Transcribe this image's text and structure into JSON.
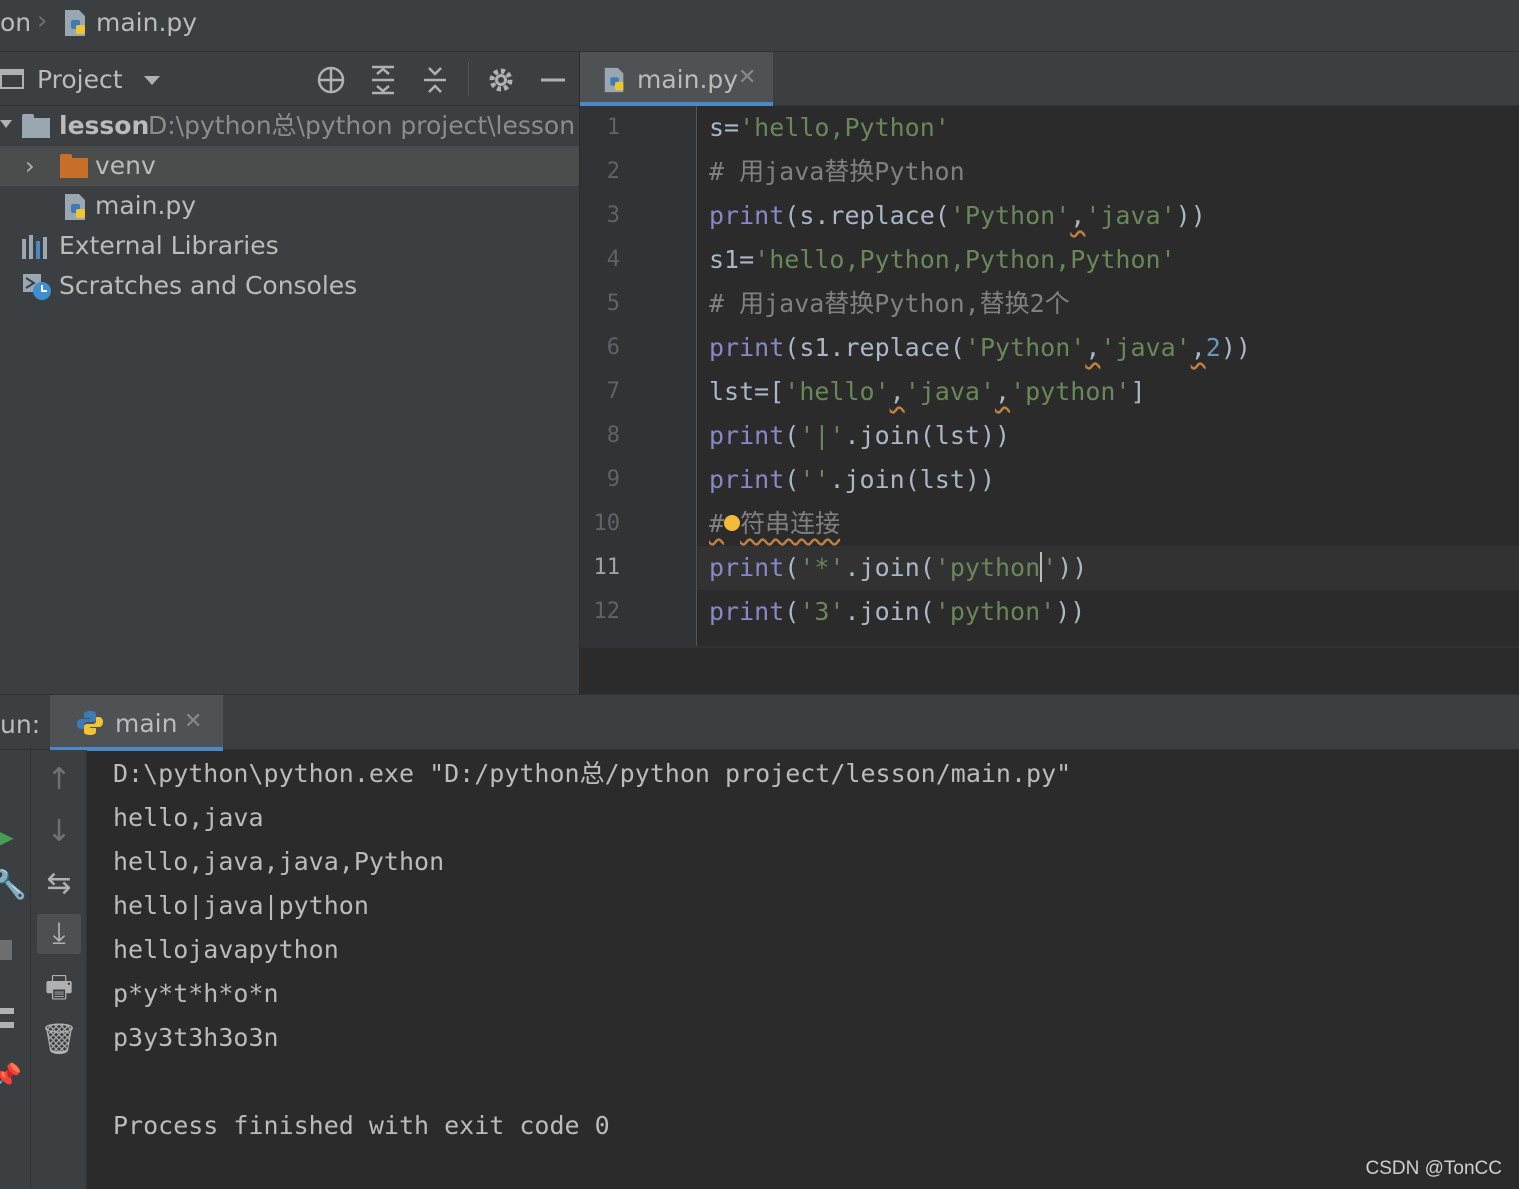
{
  "breadcrumb": {
    "project": "on",
    "file": "main.py"
  },
  "project_panel": {
    "title": "Project",
    "tree": {
      "root_name": "lesson",
      "root_path": "D:\\python总\\python project\\lesson",
      "venv": "venv",
      "main": "main.py",
      "ext_libs": "External Libraries",
      "scratches": "Scratches and Consoles"
    }
  },
  "editor": {
    "tab": "main.py",
    "line_numbers": [
      "1",
      "2",
      "3",
      "4",
      "5",
      "6",
      "7",
      "8",
      "9",
      "10",
      "11",
      "12"
    ],
    "current_line": "11"
  },
  "code": {
    "l1": {
      "a": "s=",
      "b": "'hello,Python'"
    },
    "l2": {
      "a": "# 用java替换Python"
    },
    "l3": {
      "a": "print",
      "b": "(s.replace(",
      "c": "'Python'",
      "d": ",",
      "e": "'java'",
      "f": "))"
    },
    "l4": {
      "a": "s1=",
      "b": "'hello,Python,Python,Python'"
    },
    "l5": {
      "a": "# 用java替换Python,替换2个"
    },
    "l6": {
      "a": "print",
      "b": "(s1.replace(",
      "c": "'Python'",
      "d": ",",
      "e": "'java'",
      "f": ",",
      "g": "2",
      "h": "))"
    },
    "l7": {
      "a": "lst=[",
      "b": "'hello'",
      "c": ",",
      "d": "'java'",
      "e": ",",
      "f": "'python'",
      "g": "]"
    },
    "l8": {
      "a": "print",
      "b": "(",
      "c": "'|'",
      "d": ".join(lst))"
    },
    "l9": {
      "a": "print",
      "b": "(",
      "c": "''",
      "d": ".join(lst))"
    },
    "l10": {
      "a": "#",
      "b": "符串连接"
    },
    "l11": {
      "a": "print",
      "b": "(",
      "c": "'*'",
      "d": ".join(",
      "e": "'python",
      "f": "'",
      "g": "))"
    },
    "l12": {
      "a": "print",
      "b": "(",
      "c": "'3'",
      "d": ".join(",
      "e": "'python'",
      "f": "))"
    }
  },
  "run_panel": {
    "label": "un:",
    "tab": "main",
    "output": [
      "D:\\python\\python.exe \"D:/python总/python project/lesson/main.py\"",
      "hello,java",
      "hello,java,java,Python",
      "hello|java|python",
      "hellojavapython",
      "p*y*t*h*o*n",
      "p3y3t3h3o3n",
      "",
      "Process finished with exit code 0"
    ]
  },
  "watermark": "CSDN @TonCC",
  "icons": [
    "python-file-icon",
    "folder-icon",
    "external-libraries-icon",
    "scratches-icon",
    "locate-icon",
    "expand-all-icon",
    "collapse-all-icon",
    "gear-icon",
    "minimize-icon",
    "close-icon",
    "run-icon",
    "wrench-icon",
    "stop-icon",
    "layout-icon",
    "pin-icon",
    "arrow-up-icon",
    "arrow-down-icon",
    "soft-wrap-icon",
    "scroll-to-end-icon",
    "print-icon",
    "trash-icon",
    "bulb-icon"
  ],
  "colors": {
    "accent": "#4a88c7",
    "keyword": "#8888c6",
    "string": "#6a8759",
    "comment": "#808080",
    "number": "#6897bb",
    "folder_venv": "#c8702a",
    "folder_root": "#9aa7b0",
    "run_green": "#499c54"
  }
}
